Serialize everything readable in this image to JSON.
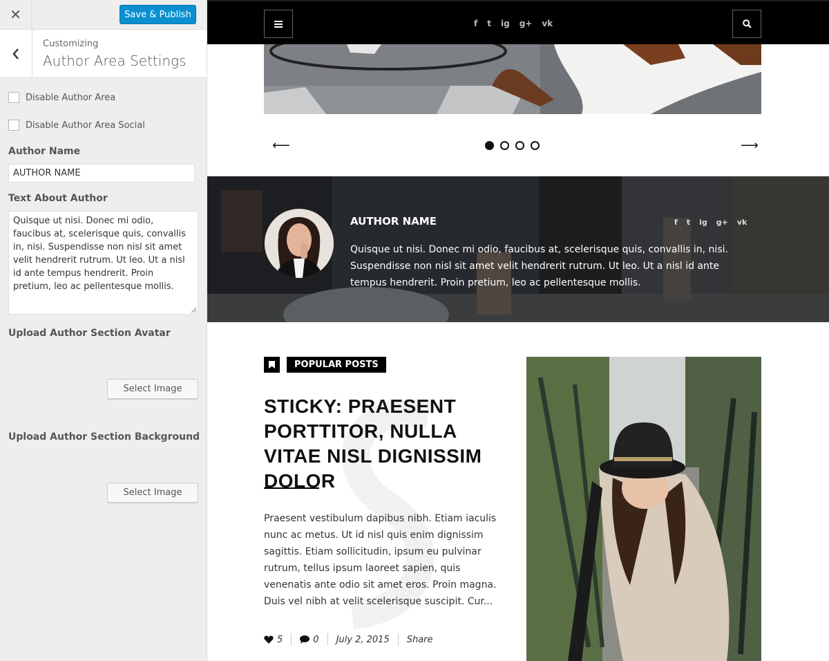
{
  "customizer": {
    "publish_label": "Save & Publish",
    "breadcrumb": "Customizing",
    "section_title": "Author Area Settings",
    "disable_author_area": "Disable Author Area",
    "disable_author_area_social": "Disable Author Area Social",
    "author_name_label": "Author Name",
    "author_name_value": "AUTHOR NAME",
    "text_about_label": "Text About Author",
    "text_about_value": "Quisque ut nisi. Donec mi odio, faucibus at, scelerisque quis, convallis in, nisi. Suspendisse non nisl sit amet velit hendrerit rutrum. Ut leo. Ut a nisl id ante tempus hendrerit. Proin pretium, leo ac pellentesque mollis.",
    "upload_avatar_label": "Upload Author Section Avatar",
    "upload_background_label": "Upload Author Section Background",
    "select_image_label": "Select Image",
    "accent_color": "#0a8fd0"
  },
  "preview": {
    "header": {
      "social_icons": [
        {
          "icon": "facebook-icon",
          "glyph": "f"
        },
        {
          "icon": "twitter-icon",
          "glyph": "t"
        },
        {
          "icon": "instagram-icon",
          "glyph": "ig"
        },
        {
          "icon": "google-plus-icon",
          "glyph": "g+"
        },
        {
          "icon": "vk-icon",
          "glyph": "vk"
        }
      ]
    },
    "slider": {
      "prev_glyph": "⟵",
      "next_glyph": "⟶",
      "slides": 4,
      "active_slide": 1
    },
    "author_area": {
      "name": "AUTHOR NAME",
      "text": "Quisque ut nisi. Donec mi odio, faucibus at, scelerisque quis, convallis in, nisi. Suspendisse non nisl sit amet velit hendrerit rutrum. Ut leo. Ut a nisl id ante tempus hendrerit. Proin pretium, leo ac pellentesque mollis."
    },
    "post": {
      "tag": "POPULAR POSTS",
      "title": "STICKY: PRAESENT PORTTITOR, NULLA VITAE NISL DIGNISSIM DOLOR",
      "excerpt": "Praesent vestibulum dapibus nibh. Etiam iaculis nunc ac metus. Ut id nisl quis enim dignissim sagittis. Etiam sollicitudin, ipsum eu pulvinar rutrum, tellus ipsum laoreet sapien, quis venenatis ante odio sit amet eros. Proin magna. Duis vel nibh at velit scelerisque suscipit. Cur...",
      "likes": "5",
      "comments": "0",
      "date": "July 2, 2015",
      "share": "Share"
    }
  }
}
